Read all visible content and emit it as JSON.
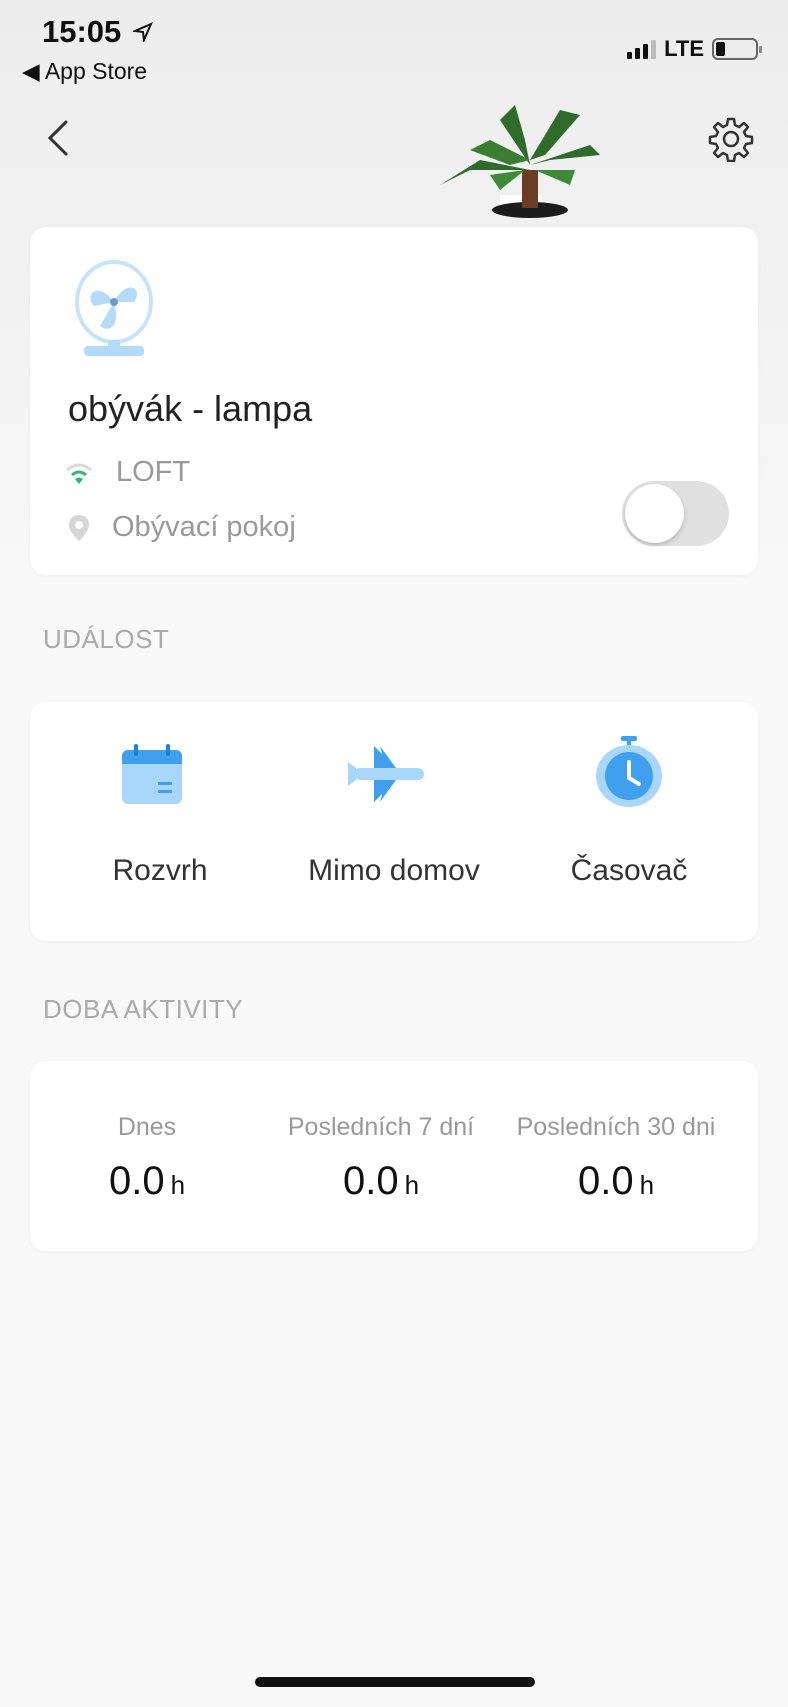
{
  "status_bar": {
    "time": "15:05",
    "back_app": "App Store",
    "network": "LTE"
  },
  "nav": {
    "back_icon": "chevron-left-icon",
    "settings_icon": "gear-icon"
  },
  "device": {
    "name": "obývák - lampa",
    "wifi": "LOFT",
    "location": "Obývací pokoj",
    "power_on": false,
    "icon": "fan-icon"
  },
  "events": {
    "title": "UDÁLOST",
    "items": [
      {
        "label": "Rozvrh",
        "icon": "calendar-icon"
      },
      {
        "label": "Mimo domov",
        "icon": "airplane-icon"
      },
      {
        "label": "Časovač",
        "icon": "stopwatch-icon"
      }
    ]
  },
  "activity": {
    "title": "DOBA AKTIVITY",
    "unit": "h",
    "items": [
      {
        "label": "Dnes",
        "value": "0.0"
      },
      {
        "label": "Posledních 7 dní",
        "value": "0.0"
      },
      {
        "label": "Posledních 30 dni",
        "value": "0.0"
      }
    ]
  },
  "colors": {
    "accent": "#3fa0f0",
    "accent_light": "#a9d6fb",
    "wifi": "#2fb86b"
  }
}
